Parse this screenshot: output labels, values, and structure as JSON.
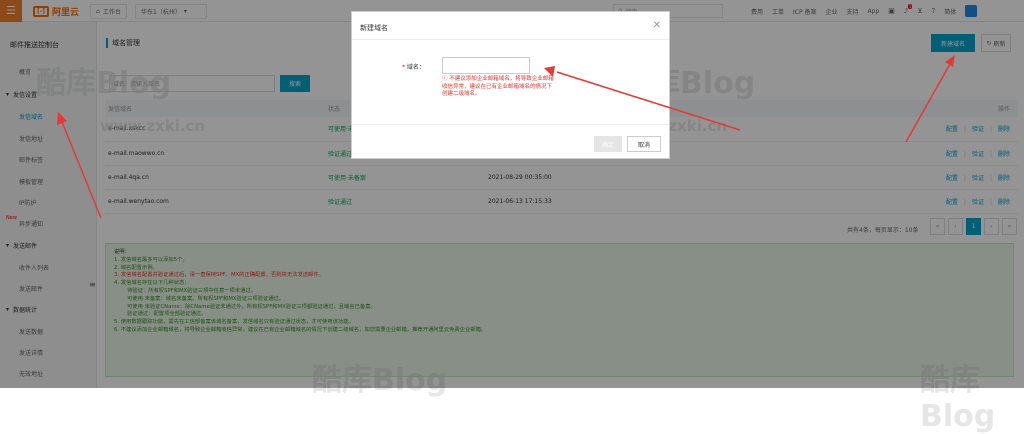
{
  "topbar": {
    "brand": "阿里云",
    "workbench": "工作台",
    "region": "华东1（杭州）",
    "search_placeholder": "搜索",
    "links": [
      "费用",
      "工单",
      "ICP 备案",
      "企业",
      "支持",
      "App"
    ],
    "notify_count": "1",
    "lang": "简体"
  },
  "sidebar": {
    "title": "邮件推送控制台",
    "items": [
      {
        "label": "概览"
      },
      {
        "label": "发信设置",
        "section": true
      },
      {
        "label": "发信域名",
        "active": true
      },
      {
        "label": "发信地址"
      },
      {
        "label": "邮件标签"
      },
      {
        "label": "模板管理"
      },
      {
        "label": "IP防护"
      },
      {
        "label": "异步通知",
        "badge": "New"
      },
      {
        "label": "发送邮件",
        "section": true
      },
      {
        "label": "收件人列表"
      },
      {
        "label": "发送邮件"
      },
      {
        "label": "数据统计",
        "section": true
      },
      {
        "label": "发送数据"
      },
      {
        "label": "发送详情"
      },
      {
        "label": "无效地址"
      }
    ]
  },
  "main": {
    "title": "域名管理",
    "new_button": "新建域名",
    "refresh_button": "刷新",
    "filter_label": "域名",
    "filter_placeholder": "请输入域名",
    "search_button": "搜索",
    "table": {
      "headers": [
        "发信域名",
        "状态",
        "",
        "操作"
      ],
      "rows": [
        {
          "domain": "e-mail.xskcc",
          "status": "可使用·未备案",
          "time": "",
          "ops": [
            "配置",
            "验证",
            "删除"
          ]
        },
        {
          "domain": "e-mail.maowwo.cn",
          "status": "验证通过",
          "time": "",
          "ops": [
            "配置",
            "验证",
            "删除"
          ]
        },
        {
          "domain": "e-mail.4qa.cn",
          "status": "可使用·未备案",
          "time": "2021-08-29 00:35:00",
          "ops": [
            "配置",
            "验证",
            "删除"
          ]
        },
        {
          "domain": "e-mail.wenytao.com",
          "status": "验证通过",
          "time": "2021-06-13 17:15:33",
          "ops": [
            "配置",
            "验证",
            "删除"
          ]
        }
      ]
    },
    "pager": {
      "info": "共有4条，每页显示：10条",
      "prev_first": "«",
      "prev": "‹",
      "current": "1",
      "next": "›",
      "next_last": "»"
    },
    "tips": {
      "title": "说明：",
      "lines": [
        {
          "text": "1. 发信域名最多可以添加5个。"
        },
        {
          "text": "2. 域名配置示例。"
        },
        {
          "text": "3. 发信域名配置并验证通过后，请一直保持SPF、MX的正确配置，否则将无法发送邮件。",
          "red": true
        },
        {
          "text": "4. 发信域名存在以下几种状态："
        },
        {
          "text": "待验证：所有权SPF和MX验证三项中任意一项未通过。",
          "indent": true
        },
        {
          "text": "可使用·未备案：域名未备案。所有权SPF和MX验证三项验证通过。",
          "indent": true
        },
        {
          "text": "可使用·未验证CName：除CName验证未通过外，所有权SPF和MX验证三项都验证通过，且域名已备案。",
          "indent": true
        },
        {
          "text": "验证通过：配置项全部验证通过。",
          "indent": true
        },
        {
          "text": "5. 使用数据跟踪功能，需先在工信部备案该域名备案，发信域名只有验证通过状态，才可使用该功能。"
        },
        {
          "text": "6. 不建议添加企业邮箱域名，将导致企业邮箱收信异常，建议在已有企业邮箱域名的情况下创建二级域名，如您需要企业邮箱，推荐开通阿里云免费企业邮箱。"
        }
      ]
    }
  },
  "modal": {
    "title": "新建域名",
    "field_label": "域名：",
    "required_mark": "*",
    "warning": "不建议添加企业邮箱域名，将导致企业邮箱收信异常，建议在已有企业邮箱域名的情况下创建二级域名。",
    "ok_button": "确定",
    "cancel_button": "取消"
  },
  "watermark": {
    "brand": "酷库Blog",
    "url": "www.zxki.cn"
  },
  "colors": {
    "accent": "#00a2ca",
    "brand": "#ff6a00",
    "success": "#00a854",
    "danger": "#e5342c",
    "annotation": "#e53935"
  }
}
